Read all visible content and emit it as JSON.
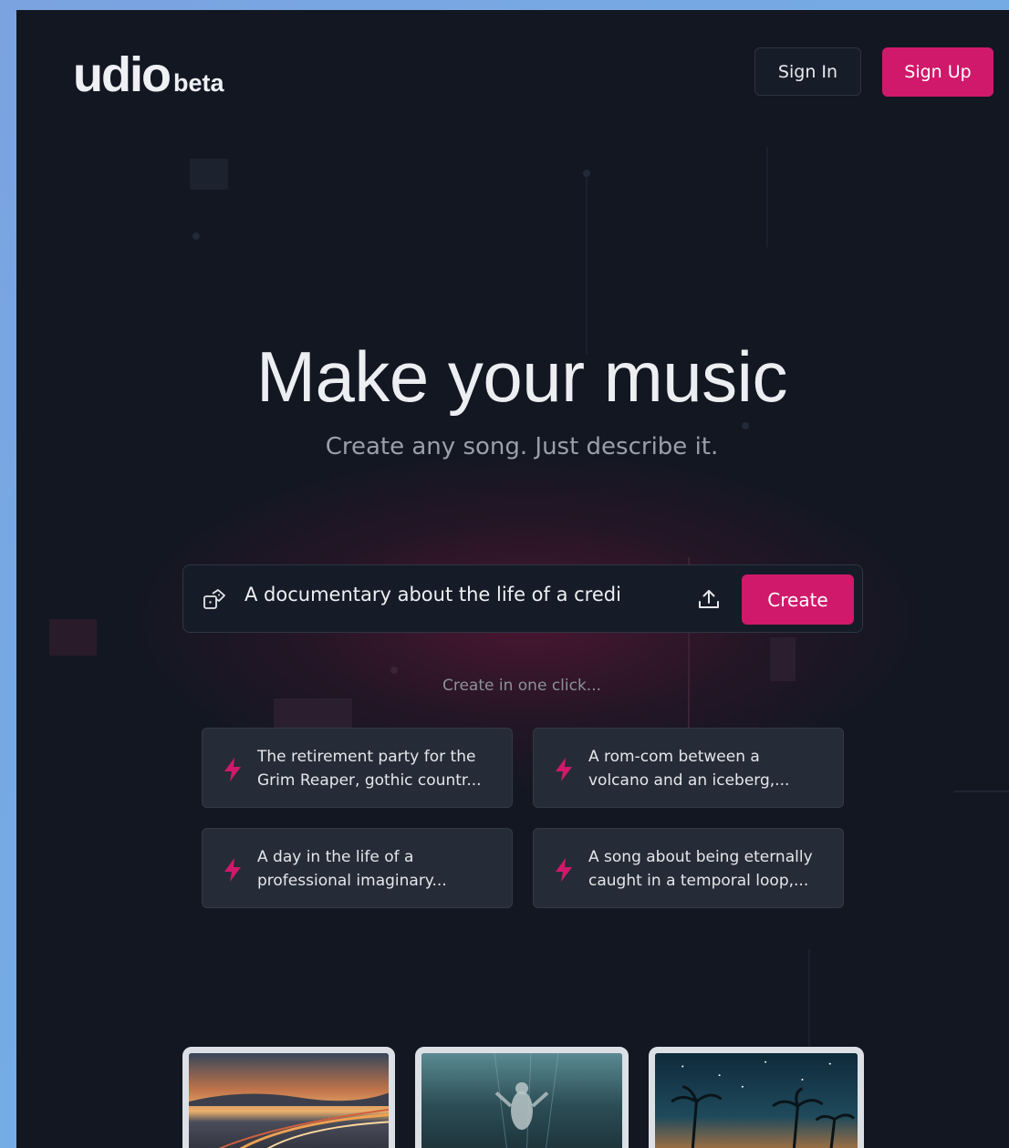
{
  "header": {
    "logo_text": "udio",
    "logo_badge": "beta",
    "sign_in_label": "Sign In",
    "sign_up_label": "Sign Up"
  },
  "hero": {
    "title": "Make your music",
    "subtitle": "Create any song. Just describe it."
  },
  "prompt": {
    "value": "A documentary about the life of a credi",
    "random_icon": "dice-icon",
    "upload_icon": "upload-icon",
    "create_label": "Create"
  },
  "suggestions": {
    "heading": "Create in one click...",
    "icon": "bolt-icon",
    "items": [
      {
        "line1": "The retirement party for the",
        "line2": "Grim Reaper, gothic countr..."
      },
      {
        "line1": "A rom-com between a",
        "line2": "volcano and an iceberg,..."
      },
      {
        "line1": "A day in the life of a",
        "line2": "professional imaginary..."
      },
      {
        "line1": "A song about being eternally",
        "line2": "caught in a temporal loop,..."
      }
    ]
  },
  "thumbnails": [
    "highway-sunset-thumbnail",
    "underwater-figure-thumbnail",
    "palm-trees-night-thumbnail"
  ],
  "colors": {
    "accent": "#d0196b",
    "background": "#121722",
    "card": "#262c37"
  }
}
